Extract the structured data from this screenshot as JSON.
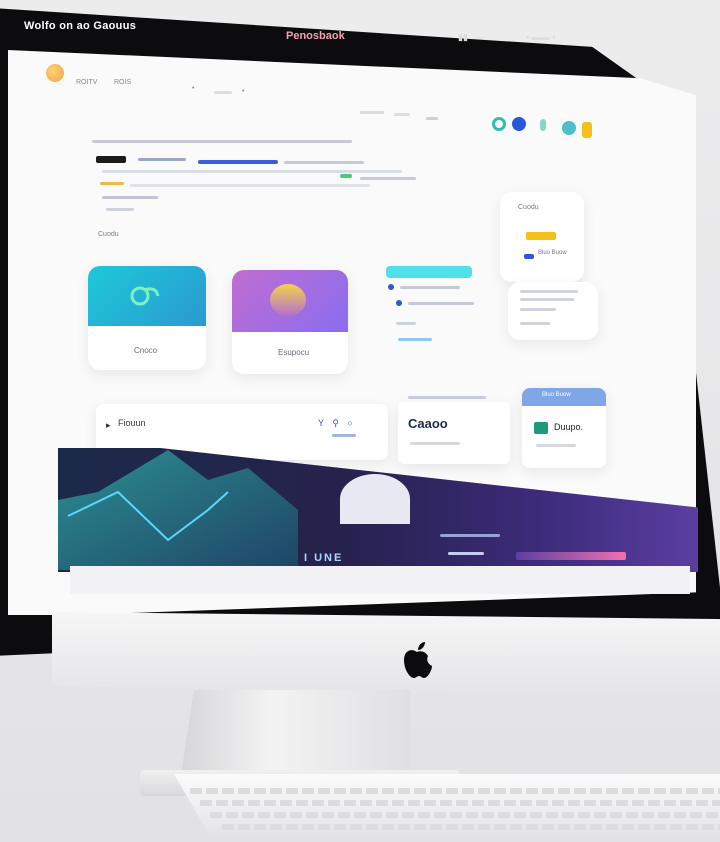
{
  "menubar": {
    "left_text": "Wolfo on ao Gaouus",
    "center_text": "Penosbaok"
  },
  "appbar": {
    "nav": [
      "ROITV",
      "ROIS"
    ]
  },
  "content": {
    "section_label": "Cuodu",
    "card_a_label": "Cnoco",
    "card_b_label": "Esupocu",
    "right_card_title": "Cuodu",
    "right_card_tag": "Bluo Buow",
    "search_text": "Fiouun",
    "bottom_card_text": "Caaoo",
    "bottom_card_button": "Bluo Buow",
    "bottom_card_small": "Duupo.",
    "banner_text": "I UNE"
  },
  "colors": {
    "accent_teal": "#1ec8d8",
    "accent_purple": "#8a6df0",
    "accent_blue": "#2a58d8",
    "accent_yellow": "#f2c01a",
    "bezel": "#0c0c0e",
    "banner_purple": "#5a3fa0"
  },
  "icons": [
    "apple-logo-icon",
    "mail-icon",
    "bell-icon",
    "profile-icon",
    "search-icon",
    "chevron-icon"
  ]
}
